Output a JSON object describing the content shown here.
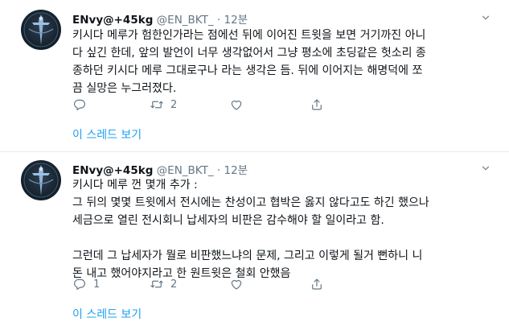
{
  "tweets": [
    {
      "display_name": "ENvy@+45kg",
      "handle": "@EN_BKT_",
      "separator": "·",
      "time": "12분",
      "lines": [
        "키시다 메루가 험한인가라는 점에선 뒤에 이어진 트윗을 보면 거기까진 아니",
        "다 싶긴 한데, 앞의 발언이 너무 생각없어서 그냥 평소에 초딩같은 헛소리 종",
        "종하던 키시다 메루 그대로구나 라는 생각은 듬. 뒤에 이어지는 해명덕에 쪼",
        "끔 실망은 누그러졌다."
      ],
      "reply_count": "",
      "retweet_count": "2",
      "like_count": "",
      "show_thread": "이 스레드 보기"
    },
    {
      "display_name": "ENvy@+45kg",
      "handle": "@EN_BKT_",
      "separator": "·",
      "time": "12분",
      "lines": [
        "키시다 메루 껀 몇개 추가 :",
        "그 뒤의 몇몇 트윗에서 전시에는 찬성이고 협박은 옳지 않다고도 하긴 했으나",
        "세금으로 열린 전시회니 납세자의 비판은 감수해야 할 일이라고 함.",
        "",
        "그런데 그 납세자가 뭘로 비판했느냐의 문제, 그리고 이렇게 될거 뻔하니 니",
        "돈 내고 했어야지라고 한 원트윗은 철회 안했음"
      ],
      "reply_count": "1",
      "retweet_count": "2",
      "like_count": "",
      "show_thread": "이 스레드 보기"
    }
  ],
  "icons": {
    "reply": "reply-icon",
    "retweet": "retweet-icon",
    "like": "like-icon",
    "share": "share-icon",
    "menu": "chevron-down-icon"
  },
  "colors": {
    "link": "#1da1f2",
    "muted": "#657786",
    "divider": "#e6ecf0"
  }
}
